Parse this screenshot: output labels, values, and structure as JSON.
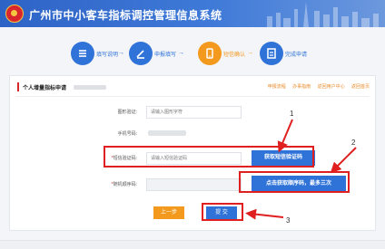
{
  "header": {
    "title": "广州市中小客车指标调控管理信息系统"
  },
  "steps": [
    {
      "label": "填写说明",
      "color": "#2f73d9"
    },
    {
      "label": "申报填写",
      "color": "#2f73d9"
    },
    {
      "label": "短信确认",
      "color": "#f39a1e"
    },
    {
      "label": "完成申请",
      "color": "#2f73d9"
    }
  ],
  "step_arrow": "→",
  "panel": {
    "title": "个人增量指标申请",
    "links": [
      "申报流程",
      "办事指南",
      "返回用户中心",
      "返回首页"
    ]
  },
  "form": {
    "verify_label": "图形验证:",
    "verify_placeholder": "请输入图形字符",
    "phone_label": "手机号码:",
    "sms_label": "短信验证码:",
    "sms_placeholder": "请输入短信验证码",
    "sms_required_mark": "*",
    "order_label": "随机顺序码:",
    "order_required_mark": "*"
  },
  "buttons": {
    "get_code": "获取短信验证码",
    "get_order": "点击获取顺序码，最多三次",
    "prev": "上一步",
    "submit": "提 交"
  },
  "annotations": [
    "1",
    "2",
    "3"
  ],
  "colors": {
    "brand_blue": "#2f73d9",
    "accent_orange": "#f39a1e",
    "annotation_red": "#e02020"
  }
}
